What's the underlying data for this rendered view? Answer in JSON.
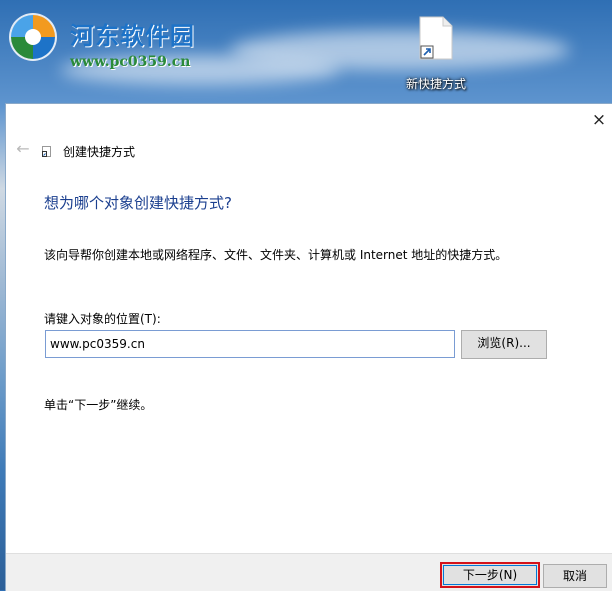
{
  "watermark": {
    "title": "河东软件园",
    "url": "www.pc0359.cn"
  },
  "desktop": {
    "icon_label": "新快捷方式",
    "icon_name": "shortcut-file-icon"
  },
  "wizard": {
    "window_title": "创建快捷方式",
    "heading": "想为哪个对象创建快捷方式?",
    "description": "该向导帮你创建本地或网络程序、文件、文件夹、计算机或 Internet 地址的快捷方式。",
    "location_label": "请键入对象的位置(T):",
    "location_value": "www.pc0359.cn",
    "browse_label": "浏览(R)...",
    "continue_hint": "单击“下一步”继续。",
    "next_label": "下一步(N)",
    "cancel_label": "取消",
    "close_glyph": "×",
    "back_glyph": "←",
    "highlight_color": "#d4121a",
    "heading_color": "#1b3f8f"
  }
}
